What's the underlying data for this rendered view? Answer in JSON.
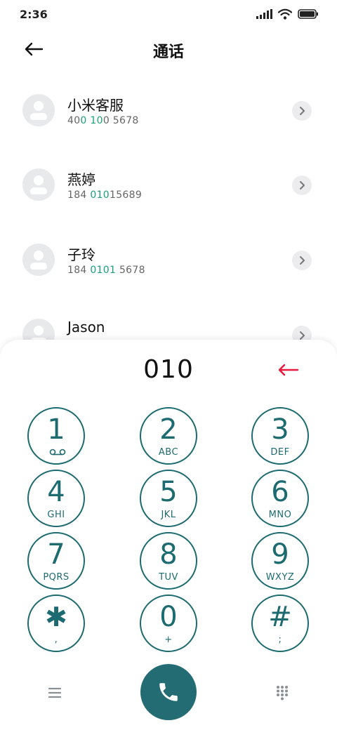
{
  "status_bar": {
    "time": "2:36",
    "icons": [
      "signal-icon",
      "wifi-icon",
      "battery-icon"
    ]
  },
  "header": {
    "title": "通话",
    "back_icon": "arrow-left-icon"
  },
  "contacts": [
    {
      "name": "小米客服",
      "number_parts": [
        "40",
        "0",
        " ",
        "10",
        "0 5678"
      ]
    },
    {
      "name": "燕婷",
      "number_parts": [
        "184 ",
        "010",
        "15689"
      ]
    },
    {
      "name": "子玲",
      "number_parts": [
        "184 ",
        "0101",
        " 5678"
      ]
    },
    {
      "name": "Jason"
    }
  ],
  "dialer": {
    "dialed_number": "010",
    "backspace_icon": "backspace-arrow-icon",
    "backspace_color": "#e8193c",
    "keys": [
      {
        "digit": "1",
        "letters": "",
        "icon": "voicemail-icon"
      },
      {
        "digit": "2",
        "letters": "ABC"
      },
      {
        "digit": "3",
        "letters": "DEF"
      },
      {
        "digit": "4",
        "letters": "GHI"
      },
      {
        "digit": "5",
        "letters": "JKL"
      },
      {
        "digit": "6",
        "letters": "MNO"
      },
      {
        "digit": "7",
        "letters": "PQRS"
      },
      {
        "digit": "8",
        "letters": "TUV"
      },
      {
        "digit": "9",
        "letters": "WXYZ"
      },
      {
        "digit": "✱",
        "letters": ","
      },
      {
        "digit": "0",
        "letters": "+"
      },
      {
        "digit": "#",
        "letters": ";"
      }
    ],
    "bottom_bar": {
      "menu_icon": "menu-icon",
      "call_icon": "phone-icon",
      "keypad_icon": "dialpad-icon"
    },
    "accent_color": "#1c6b70",
    "highlight_color": "#1aa07a"
  }
}
